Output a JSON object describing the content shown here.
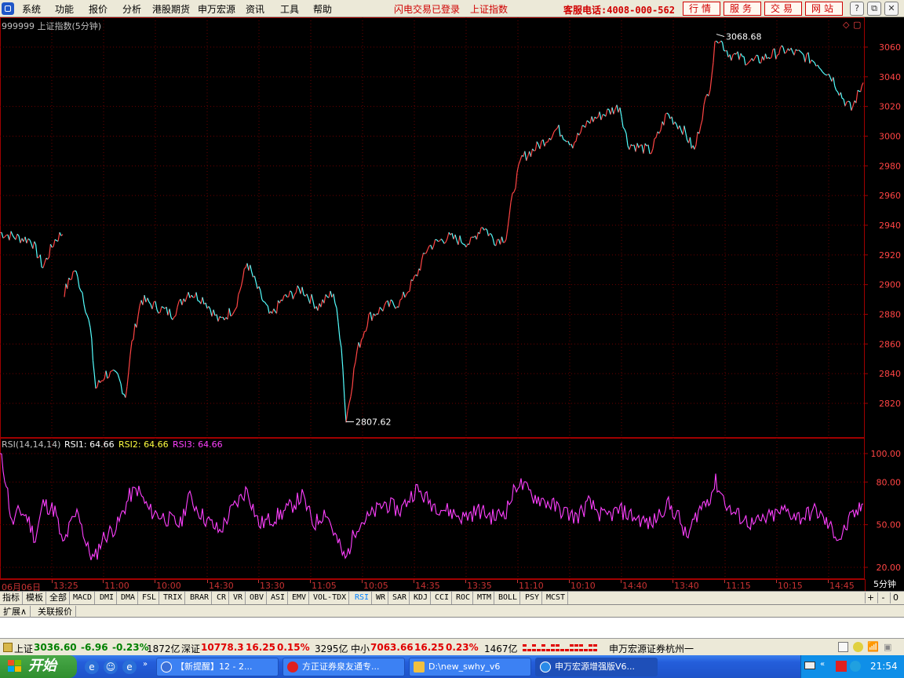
{
  "menubar": {
    "items": [
      "系统",
      "功能",
      "报价",
      "分析",
      "港股期货",
      "申万宏源",
      "资讯",
      "工具",
      "帮助"
    ],
    "status_msg": "闪电交易已登录",
    "current_index": "上证指数",
    "hotline": "客服电话:4008-000-562",
    "buttons": [
      "行情",
      "服务",
      "交易",
      "网站"
    ],
    "window_controls": [
      "?",
      "⧉",
      "✕"
    ]
  },
  "price_chart": {
    "title": "999999 上证指数(5分钟)",
    "high_label": "3068.68",
    "low_label": "2807.62"
  },
  "rsi": {
    "params": "RSI(14,14,14)",
    "rsi1_label": "RSI1: 64.66",
    "rsi2_label": "RSI2: 64.66",
    "rsi3_label": "RSI3: 64.66",
    "axis": [
      "100.00",
      "80.00",
      "50.00",
      "20.00"
    ]
  },
  "time_axis": {
    "labels": [
      "06月06日",
      "13:25",
      "11:00",
      "10:00",
      "14:30",
      "13:30",
      "11:05",
      "10:05",
      "14:35",
      "13:35",
      "11:10",
      "10:10",
      "14:40",
      "13:40",
      "11:15",
      "10:15",
      "14:45"
    ],
    "period": "5分钟"
  },
  "indicator_tabs": {
    "cn_tabs": [
      "指标",
      "模板",
      "全部"
    ],
    "tabs": [
      "MACD",
      "DMI",
      "DMA",
      "FSL",
      "TRIX",
      "BRAR",
      "CR",
      "VR",
      "OBV",
      "ASI",
      "EMV",
      "VOL-TDX",
      "RSI",
      "WR",
      "SAR",
      "KDJ",
      "CCI",
      "ROC",
      "MTM",
      "BOLL",
      "PSY",
      "MCST"
    ],
    "active": "RSI",
    "controls": [
      "+",
      "-",
      "0"
    ]
  },
  "ext_tabs": [
    "扩展∧",
    "关联报价"
  ],
  "status_bar": {
    "sh_name": "上证",
    "sh_value": "3036.60",
    "sh_change": "-6.96",
    "sh_pct": "-0.23%",
    "sh_volume": "1872亿",
    "sz_name": "深证",
    "sz_value": "10778.3",
    "sz_change": "16.25",
    "sz_pct": "0.15%",
    "sz_volume": "3295亿",
    "zx_name": "中小",
    "zx_value": "7063.66",
    "zx_change": "16.25",
    "zx_pct": "0.23%",
    "zx_volume": "1467亿",
    "broker": "申万宏源证券杭州一"
  },
  "taskbar": {
    "start_label": "开始",
    "tasks": [
      "【新提醒】12 - 2...",
      "方正证券泉友通专...",
      "D:\\new_swhy_v6",
      "申万宏源增强版V6..."
    ],
    "active_task": 3,
    "clock": "21:54"
  },
  "chart_data": [
    {
      "type": "candlestick-line",
      "title": "999999 上证指数(5分钟)",
      "ylim": [
        2800,
        3070
      ],
      "yticks": [
        2820,
        2840,
        2860,
        2880,
        2900,
        2920,
        2940,
        2960,
        2980,
        3000,
        3020,
        3040,
        3060
      ],
      "annotations": [
        {
          "label": "3068.68",
          "value": 3068.68
        },
        {
          "label": "2807.62",
          "value": 2807.62
        }
      ],
      "keypoints": [
        [
          0,
          2935
        ],
        [
          20,
          2932
        ],
        [
          40,
          2930
        ],
        [
          55,
          2912
        ],
        [
          70,
          2930
        ],
        [
          80,
          2935
        ],
        [
          82,
          2895
        ],
        [
          95,
          2910
        ],
        [
          105,
          2895
        ],
        [
          115,
          2870
        ],
        [
          122,
          2830
        ],
        [
          135,
          2840
        ],
        [
          150,
          2838
        ],
        [
          160,
          2825
        ],
        [
          168,
          2860
        ],
        [
          180,
          2890
        ],
        [
          200,
          2885
        ],
        [
          220,
          2880
        ],
        [
          240,
          2895
        ],
        [
          260,
          2890
        ],
        [
          280,
          2875
        ],
        [
          300,
          2885
        ],
        [
          315,
          2915
        ],
        [
          330,
          2895
        ],
        [
          345,
          2878
        ],
        [
          360,
          2890
        ],
        [
          385,
          2897
        ],
        [
          405,
          2885
        ],
        [
          425,
          2895
        ],
        [
          435,
          2860
        ],
        [
          441,
          2808
        ],
        [
          455,
          2855
        ],
        [
          470,
          2878
        ],
        [
          490,
          2885
        ],
        [
          510,
          2888
        ],
        [
          530,
          2905
        ],
        [
          545,
          2925
        ],
        [
          570,
          2932
        ],
        [
          600,
          2928
        ],
        [
          615,
          2940
        ],
        [
          630,
          2930
        ],
        [
          645,
          2932
        ],
        [
          655,
          2965
        ],
        [
          665,
          2985
        ],
        [
          690,
          2995
        ],
        [
          710,
          3005
        ],
        [
          730,
          2995
        ],
        [
          750,
          3010
        ],
        [
          770,
          3015
        ],
        [
          790,
          3020
        ],
        [
          800,
          2995
        ],
        [
          830,
          2990
        ],
        [
          850,
          3015
        ],
        [
          870,
          3005
        ],
        [
          885,
          2990
        ],
        [
          895,
          3015
        ],
        [
          905,
          3035
        ],
        [
          913,
          3068
        ],
        [
          930,
          3055
        ],
        [
          960,
          3050
        ],
        [
          985,
          3055
        ],
        [
          1000,
          3058
        ],
        [
          1020,
          3055
        ],
        [
          1040,
          3050
        ],
        [
          1060,
          3040
        ],
        [
          1075,
          3025
        ],
        [
          1085,
          3018
        ],
        [
          1095,
          3030
        ],
        [
          1100,
          3036
        ]
      ]
    },
    {
      "type": "line",
      "title": "RSI(14,14,14)",
      "series": [
        {
          "name": "RSI1"
        },
        {
          "name": "RSI2"
        },
        {
          "name": "RSI3"
        }
      ],
      "ylim": [
        0,
        100
      ],
      "yticks": [
        20,
        50,
        80,
        100
      ],
      "keypoints": [
        [
          0,
          100
        ],
        [
          8,
          80
        ],
        [
          15,
          50
        ],
        [
          25,
          60
        ],
        [
          35,
          55
        ],
        [
          45,
          40
        ],
        [
          55,
          65
        ],
        [
          70,
          60
        ],
        [
          80,
          35
        ],
        [
          90,
          50
        ],
        [
          100,
          60
        ],
        [
          110,
          35
        ],
        [
          120,
          25
        ],
        [
          130,
          40
        ],
        [
          150,
          50
        ],
        [
          165,
          70
        ],
        [
          175,
          75
        ],
        [
          190,
          60
        ],
        [
          210,
          55
        ],
        [
          230,
          50
        ],
        [
          240,
          70
        ],
        [
          260,
          55
        ],
        [
          280,
          45
        ],
        [
          295,
          60
        ],
        [
          315,
          75
        ],
        [
          330,
          50
        ],
        [
          350,
          55
        ],
        [
          365,
          60
        ],
        [
          385,
          70
        ],
        [
          400,
          50
        ],
        [
          415,
          60
        ],
        [
          425,
          45
        ],
        [
          440,
          25
        ],
        [
          455,
          50
        ],
        [
          470,
          55
        ],
        [
          490,
          65
        ],
        [
          510,
          60
        ],
        [
          530,
          75
        ],
        [
          550,
          65
        ],
        [
          570,
          60
        ],
        [
          590,
          55
        ],
        [
          610,
          60
        ],
        [
          630,
          55
        ],
        [
          645,
          60
        ],
        [
          660,
          80
        ],
        [
          680,
          70
        ],
        [
          700,
          65
        ],
        [
          715,
          60
        ],
        [
          735,
          55
        ],
        [
          750,
          65
        ],
        [
          770,
          55
        ],
        [
          790,
          60
        ],
        [
          810,
          55
        ],
        [
          830,
          50
        ],
        [
          850,
          65
        ],
        [
          865,
          55
        ],
        [
          875,
          40
        ],
        [
          890,
          60
        ],
        [
          905,
          70
        ],
        [
          912,
          80
        ],
        [
          930,
          60
        ],
        [
          945,
          55
        ],
        [
          960,
          50
        ],
        [
          980,
          55
        ],
        [
          1000,
          60
        ],
        [
          1020,
          55
        ],
        [
          1040,
          60
        ],
        [
          1055,
          50
        ],
        [
          1070,
          40
        ],
        [
          1085,
          55
        ],
        [
          1095,
          60
        ],
        [
          1100,
          64.66
        ]
      ]
    }
  ],
  "colors": {
    "up": "#ff4444",
    "down": "#54ffff",
    "grid": "#6b0000",
    "rsi": "#ff40ff",
    "rsi2": "#ffff40",
    "rsi3": "#ff40ff"
  }
}
